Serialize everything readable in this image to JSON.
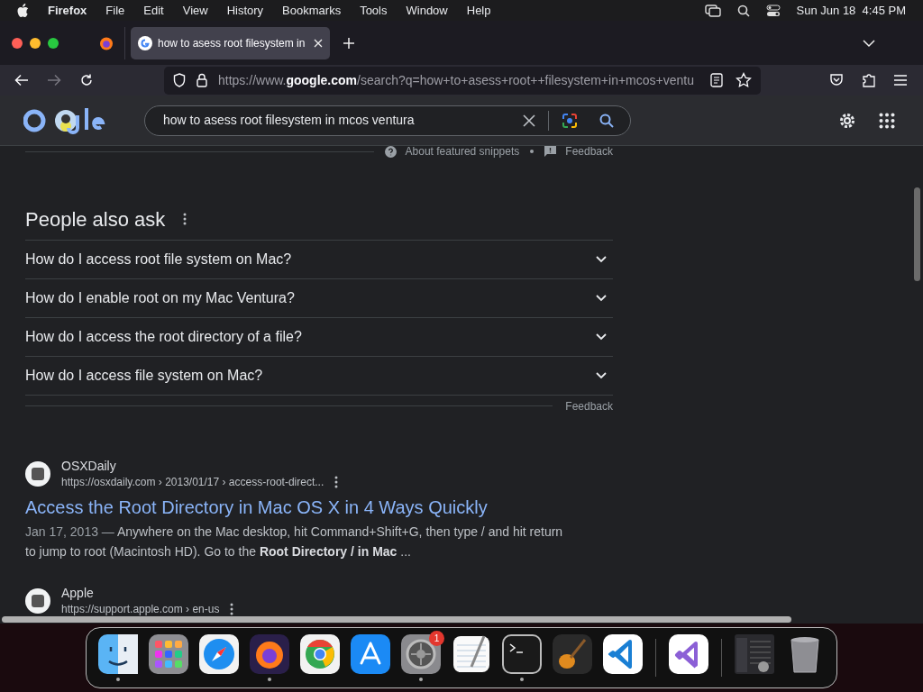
{
  "menu_bar": {
    "app": "Firefox",
    "items": [
      "File",
      "Edit",
      "View",
      "History",
      "Bookmarks",
      "Tools",
      "Window",
      "Help"
    ],
    "clock": "Sun Jun 18  4:45 PM"
  },
  "tabs": [
    {
      "title": "how to asess root filesystem in",
      "selected": true
    }
  ],
  "address_bar": {
    "url": "https://www.**google.com**/search?q=how+to+asess+root++filesystem+in+mcos+ventu"
  },
  "search": {
    "query": "how to asess root filesystem in mcos ventura"
  },
  "snippet_footer": {
    "about": "About featured snippets",
    "feedback": "Feedback"
  },
  "people_also_ask": {
    "title": "People also ask",
    "questions": [
      {
        "text": "How do I access root file system on Mac?",
        "expanded": false
      },
      {
        "text": "How do I enable root on my Mac Ventura?",
        "expanded": false
      },
      {
        "text": "How do I access the root directory of a file?",
        "expanded": false
      },
      {
        "text": "How do I access file system on Mac?",
        "expanded": false
      }
    ],
    "feedback": "Feedback"
  },
  "results": [
    {
      "site": "OSXDaily",
      "url": "https://osxdaily.com › 2013/01/17 › access-root-direct...",
      "title": "Access the Root Directory in Mac OS X in 4 Ways Quickly",
      "date": "Jan 17, 2013 —",
      "snippet": "Anywhere on the Mac desktop, hit Command+Shift+G, then type / and hit return to jump to root (Macintosh HD). Go to the **Root Directory / in Mac** ..."
    },
    {
      "site": "Apple",
      "url": "https://support.apple.com › en-us"
    }
  ],
  "dock": {
    "sections": [
      [
        {
          "kind": "finder",
          "running": true
        },
        {
          "kind": "launchpad",
          "running": false
        },
        {
          "kind": "safari",
          "running": false
        },
        {
          "kind": "firefox",
          "running": true
        },
        {
          "kind": "chrome",
          "running": false
        },
        {
          "kind": "appstore",
          "running": false
        },
        {
          "kind": "settings",
          "running": true,
          "badge": "1"
        },
        {
          "kind": "textedit",
          "running": false
        },
        {
          "kind": "terminal",
          "running": true
        },
        {
          "kind": "garageband",
          "running": false
        },
        {
          "kind": "vscode",
          "running": false
        }
      ],
      [
        {
          "kind": "visualstudio",
          "running": false
        }
      ],
      [
        {
          "kind": "window",
          "running": false
        },
        {
          "kind": "trash",
          "running": false
        }
      ]
    ]
  }
}
